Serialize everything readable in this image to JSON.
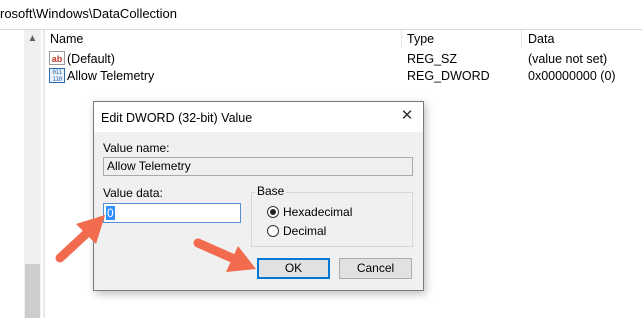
{
  "address_bar": {
    "path": "rosoft\\Windows\\DataCollection"
  },
  "tree_pane": {
    "scroll_up_glyph": "▲"
  },
  "list": {
    "columns": [
      "Name",
      "Type",
      "Data"
    ],
    "rows": [
      {
        "icon": "string-value-icon",
        "icon_text": "ab",
        "name": "(Default)",
        "type": "REG_SZ",
        "data": "(value not set)"
      },
      {
        "icon": "binary-value-icon",
        "icon_text": "011 110",
        "name": "Allow Telemetry",
        "type": "REG_DWORD",
        "data": "0x00000000 (0)"
      }
    ]
  },
  "dialog": {
    "title": "Edit DWORD (32-bit) Value",
    "close_glyph": "✕",
    "value_name_label": "Value name:",
    "value_name": "Allow Telemetry",
    "value_data_label": "Value data:",
    "value_data": "0",
    "base_label": "Base",
    "base_options": [
      {
        "label": "Hexadecimal",
        "selected": true
      },
      {
        "label": "Decimal",
        "selected": false
      }
    ],
    "ok_label": "OK",
    "cancel_label": "Cancel"
  },
  "colors": {
    "arrow": "#f26b4f",
    "accent": "#0078d7",
    "selection": "#3390ff"
  }
}
